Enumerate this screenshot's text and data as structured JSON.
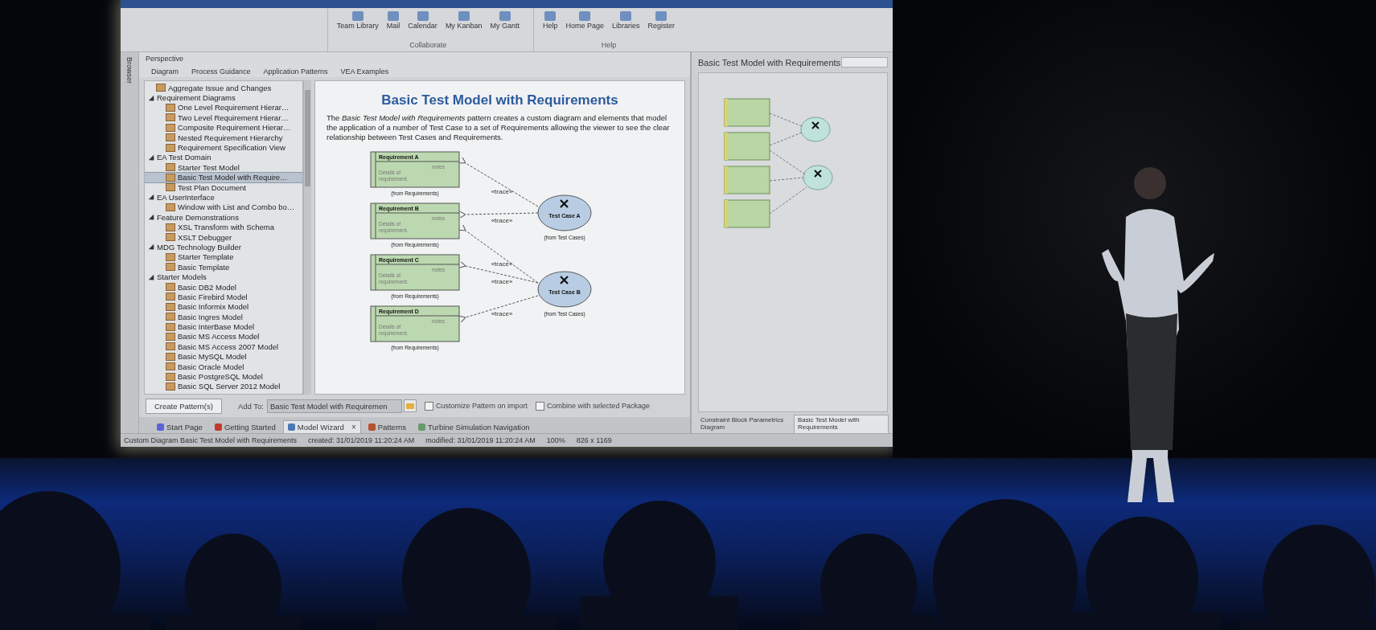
{
  "screen": {
    "ribbon": {
      "groups": [
        {
          "label": "Collaborate",
          "items": [
            "Team Library",
            "Mail",
            "Calendar",
            "My Kanban",
            "My Gantt"
          ]
        },
        {
          "label": "Help",
          "items": [
            "Help",
            "Home Page",
            "Libraries",
            "Register"
          ]
        }
      ]
    },
    "browser_label": "Browser",
    "wizard": {
      "perspective_label": "Perspective",
      "tabs": [
        {
          "label": "Diagram",
          "selected": false
        },
        {
          "label": "Process Guidance",
          "selected": false
        },
        {
          "label": "Application Patterns",
          "selected": false
        },
        {
          "label": "VEA Examples",
          "selected": false
        }
      ],
      "tree": [
        {
          "label": "Aggregate Issue and Changes",
          "selected": false
        },
        {
          "label": "Requirement Diagrams",
          "expanded": true,
          "children": [
            {
              "label": "One Level Requirement Hierar…",
              "selected": false
            },
            {
              "label": "Two Level Requirement Hierar…",
              "selected": false
            },
            {
              "label": "Composite Requirement Hierar…",
              "selected": false
            },
            {
              "label": "Nested Requirement Hierarchy",
              "selected": false
            },
            {
              "label": "Requirement Specification View",
              "selected": false
            }
          ]
        },
        {
          "label": "EA Test Domain",
          "expanded": true,
          "children": [
            {
              "label": "Starter Test Model",
              "selected": false
            },
            {
              "label": "Basic Test Model with Require…",
              "selected": true
            },
            {
              "label": "Test Plan Document",
              "selected": false
            }
          ]
        },
        {
          "label": "EA UserInterface",
          "expanded": true,
          "children": [
            {
              "label": "Window with List and Combo bo…",
              "selected": false
            }
          ]
        },
        {
          "label": "Feature Demonstrations",
          "expanded": true,
          "children": [
            {
              "label": "XSL Transform with Schema",
              "selected": false
            },
            {
              "label": "XSLT Debugger",
              "selected": false
            }
          ]
        },
        {
          "label": "MDG Technology Builder",
          "expanded": true,
          "children": [
            {
              "label": "Starter Template",
              "selected": false
            },
            {
              "label": "Basic Template",
              "selected": false
            }
          ]
        },
        {
          "label": "Starter Models",
          "expanded": true,
          "children": [
            {
              "label": "Basic DB2 Model",
              "selected": false
            },
            {
              "label": "Basic Firebird Model",
              "selected": false
            },
            {
              "label": "Basic Informix Model",
              "selected": false
            },
            {
              "label": "Basic Ingres Model",
              "selected": false
            },
            {
              "label": "Basic InterBase Model",
              "selected": false
            },
            {
              "label": "Basic MS Access Model",
              "selected": false
            },
            {
              "label": "Basic MS Access 2007 Model",
              "selected": false
            },
            {
              "label": "Basic MySQL Model",
              "selected": false
            },
            {
              "label": "Basic Oracle Model",
              "selected": false
            },
            {
              "label": "Basic PostgreSQL Model",
              "selected": false
            },
            {
              "label": "Basic SQL Server 2012 Model",
              "selected": false
            }
          ]
        }
      ],
      "title": "Basic Test Model with Requirements",
      "description": "The *Basic Test Model with Requirements* pattern creates a custom diagram and elements that model the application of a number of Test Case to a set of Requirements allowing the viewer to see the clear relationship between Test Cases and Requirements.",
      "diagram": {
        "requirements": [
          {
            "name": "Requirement A",
            "notes": "notes",
            "details": "Details of requirement.",
            "origin": "(from Requirements)",
            "traces": [
              {
                "kind": "upper",
                "label": "«trace»"
              }
            ]
          },
          {
            "name": "Requirement B",
            "notes": "notes",
            "details": "Details of requirement.",
            "origin": "(from Requirements)",
            "traces": [
              {
                "kind": "upper",
                "label": "«trace»"
              },
              {
                "kind": "lower",
                "label": "«trace»"
              }
            ]
          },
          {
            "name": "Requirement C",
            "notes": "notes",
            "details": "Details of requirement.",
            "origin": "(from Requirements)",
            "traces": [
              {
                "kind": "lower",
                "label": "«trace»"
              }
            ]
          },
          {
            "name": "Requirement D",
            "notes": "notes",
            "details": "Details of requirement.",
            "origin": "(from Requirements)",
            "traces": [
              {
                "kind": "lower",
                "label": "«trace»"
              }
            ]
          }
        ],
        "test_cases": [
          {
            "kind": "upper",
            "name": "Test Case A",
            "origin": "(from Test Cases)"
          },
          {
            "kind": "lower",
            "name": "Test Case B",
            "origin": "(from Test Cases)"
          }
        ]
      },
      "create_button": "Create Pattern(s)",
      "add_to_label": "Add To:",
      "add_to_value": "Basic Test Model with Requiremen",
      "options": [
        {
          "label": "Customize Pattern on import",
          "checked": false
        },
        {
          "label": "Combine with selected Package",
          "checked": false
        }
      ],
      "doc_tabs": [
        {
          "label": "Start Page",
          "selected": false
        },
        {
          "label": "Getting Started",
          "selected": false
        },
        {
          "label": "Model Wizard",
          "selected": true,
          "close": "×"
        },
        {
          "label": "Patterns",
          "selected": false
        },
        {
          "label": "Turbine Simulation Navigation",
          "selected": false
        }
      ]
    },
    "preview": {
      "title": "Basic Test Model with Requirements",
      "tabs": [
        {
          "label": "Constraint Block Parametrics Diagram",
          "selected": false
        },
        {
          "label": "Basic Test Model with Requirements",
          "selected": true
        }
      ]
    },
    "status_bar": {
      "diagram": "Custom Diagram Basic Test Model with Requirements",
      "created": "created: 31/01/2019 11:20:24 AM",
      "modified": "modified: 31/01/2019 11:20:24 AM",
      "zoom": "100%",
      "size": "826 x 1169"
    }
  }
}
